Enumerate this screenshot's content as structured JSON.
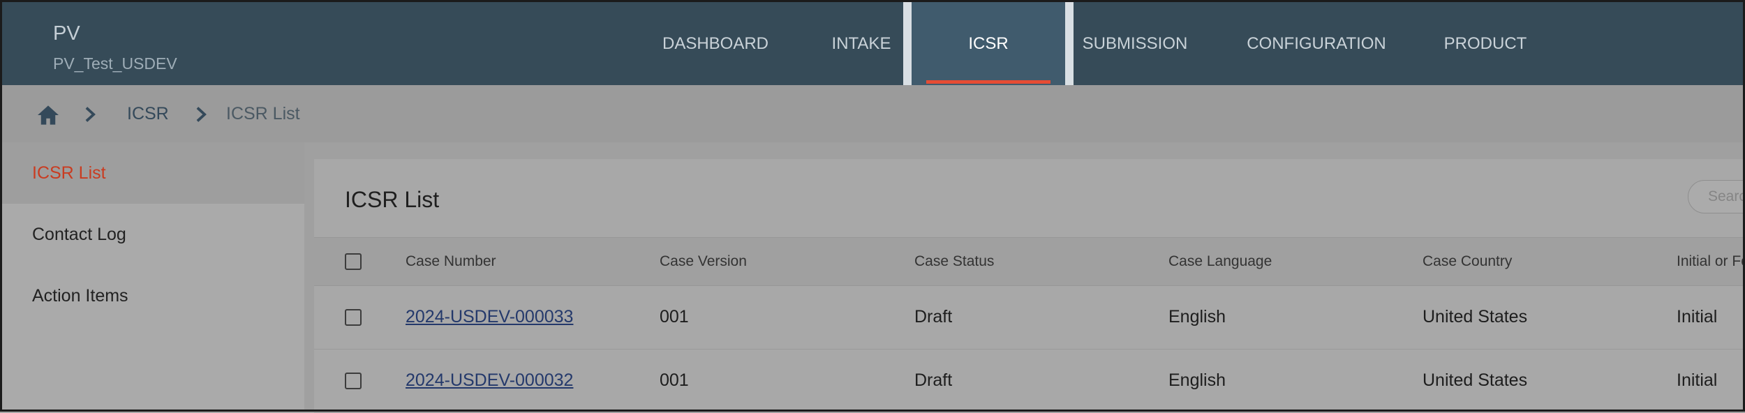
{
  "brand": {
    "name": "PV",
    "environment": "PV_Test_USDEV"
  },
  "nav": {
    "items": [
      {
        "label": "DASHBOARD"
      },
      {
        "label": "INTAKE"
      },
      {
        "label": "ICSR",
        "active": true
      },
      {
        "label": "SUBMISSION"
      },
      {
        "label": "CONFIGURATION"
      },
      {
        "label": "PRODUCT"
      }
    ]
  },
  "breadcrumb": {
    "items": [
      "ICSR",
      "ICSR List"
    ]
  },
  "sidebar": {
    "items": [
      {
        "label": "ICSR List",
        "active": true
      },
      {
        "label": "Contact Log"
      },
      {
        "label": "Action Items"
      }
    ]
  },
  "list": {
    "title": "ICSR List",
    "search_placeholder": "Search",
    "columns": [
      "Case Number",
      "Case Version",
      "Case Status",
      "Case Language",
      "Case Country",
      "Initial or Follow-up"
    ],
    "rows": [
      {
        "case_number": "2024-USDEV-000033",
        "case_version": "001",
        "case_status": "Draft",
        "case_language": "English",
        "case_country": "United States",
        "initial_followup": "Initial"
      },
      {
        "case_number": "2024-USDEV-000032",
        "case_version": "001",
        "case_status": "Draft",
        "case_language": "English",
        "case_country": "United States",
        "initial_followup": "Initial"
      }
    ]
  },
  "colors": {
    "topbar": "#364b58",
    "active_nav": "#405b6d",
    "accent": "#e64c34",
    "link": "#24396b"
  }
}
